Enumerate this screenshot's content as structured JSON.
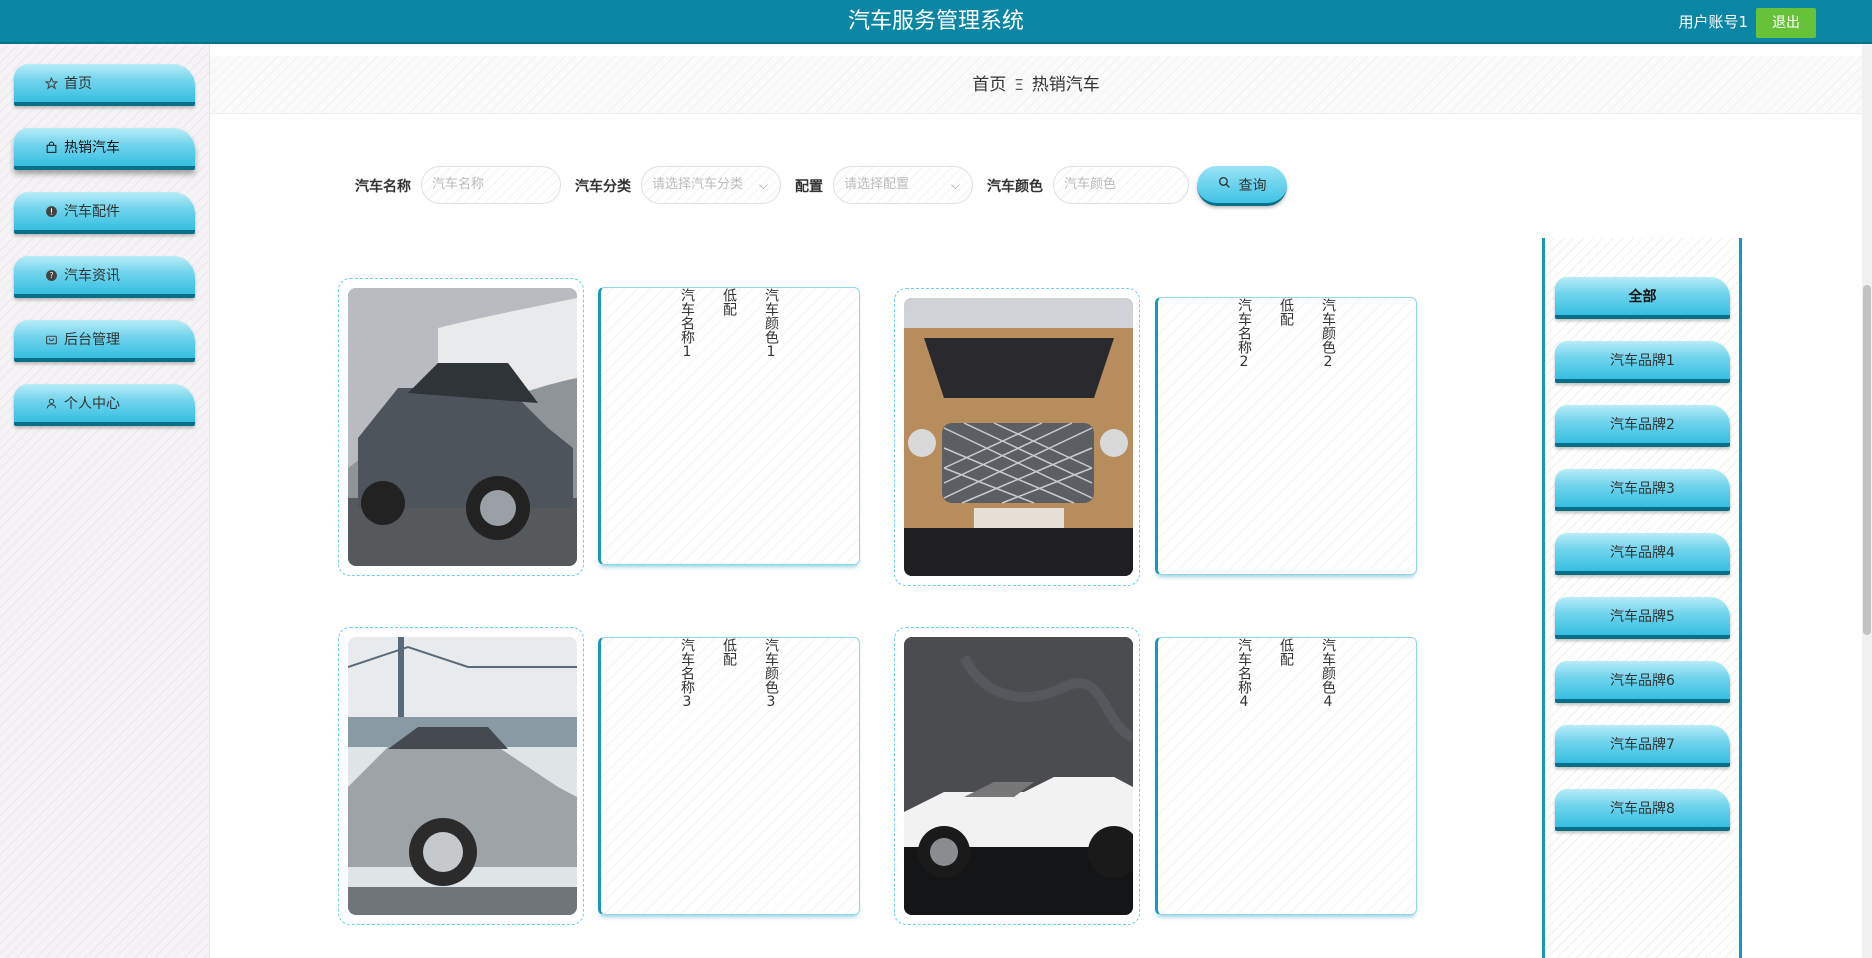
{
  "header": {
    "title": "汽车服务管理系统",
    "user": "用户账号1",
    "logout_label": "退出"
  },
  "sidebar": {
    "items": [
      {
        "label": "首页",
        "icon": "star-icon"
      },
      {
        "label": "热销汽车",
        "icon": "shopping-bag-icon",
        "active": true
      },
      {
        "label": "汽车配件",
        "icon": "info-circle-icon"
      },
      {
        "label": "汽车资讯",
        "icon": "question-circle-icon"
      },
      {
        "label": "后台管理",
        "icon": "shopping-cart-icon"
      },
      {
        "label": "个人中心",
        "icon": "user-icon"
      }
    ]
  },
  "breadcrumb": {
    "home": "首页",
    "separator": "Ξ",
    "current": "热销汽车"
  },
  "search": {
    "name_label": "汽车名称",
    "name_placeholder": "汽车名称",
    "category_label": "汽车分类",
    "category_placeholder": "请选择汽车分类",
    "config_label": "配置",
    "config_placeholder": "请选择配置",
    "color_label": "汽车颜色",
    "color_placeholder": "汽车颜色",
    "query_label": "查询"
  },
  "cars": [
    {
      "name": "汽车名称1",
      "config": "低配",
      "color": "汽车颜色1"
    },
    {
      "name": "汽车名称2",
      "config": "低配",
      "color": "汽车颜色2"
    },
    {
      "name": "汽车名称3",
      "config": "低配",
      "color": "汽车颜色3"
    },
    {
      "name": "汽车名称4",
      "config": "低配",
      "color": "汽车颜色4"
    }
  ],
  "brands": {
    "items": [
      "全部",
      "汽车品牌1",
      "汽车品牌2",
      "汽车品牌3",
      "汽车品牌4",
      "汽车品牌5",
      "汽车品牌6",
      "汽车品牌7",
      "汽车品牌8"
    ]
  },
  "colors": {
    "header_bg": "#0b86a4",
    "accent": "#36bfe2",
    "logout_bg": "#67c23a"
  }
}
